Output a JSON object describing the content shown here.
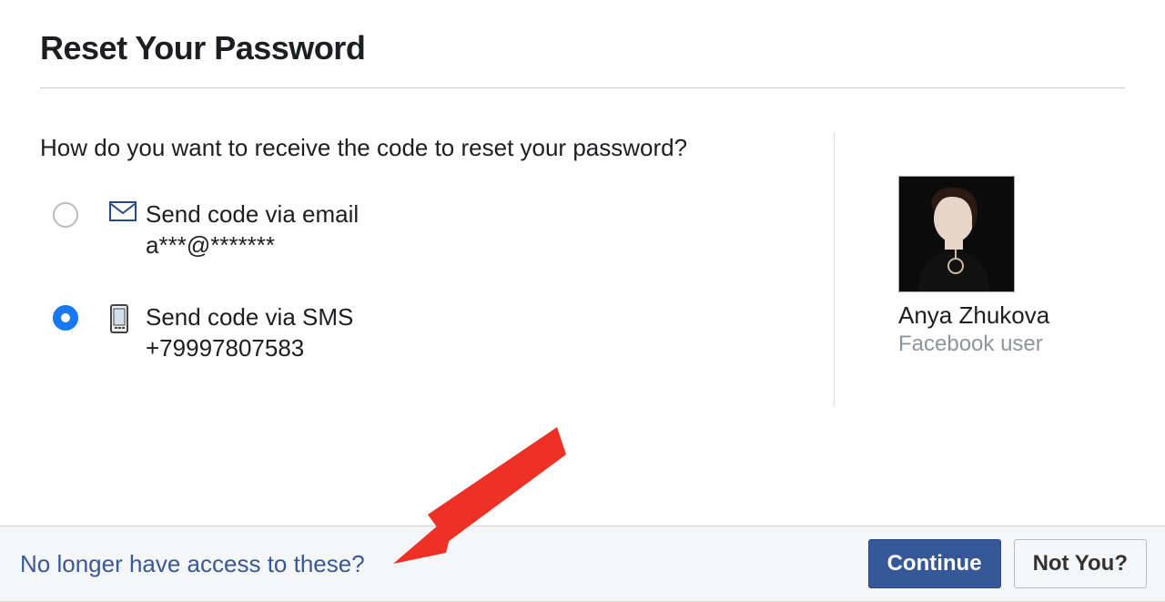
{
  "title": "Reset Your Password",
  "prompt": "How do you want to receive the code to reset your password?",
  "options": [
    {
      "label": "Send code via email",
      "detail": "a***@*******",
      "selected": false
    },
    {
      "label": "Send code via SMS",
      "detail": "+79997807583",
      "selected": true
    }
  ],
  "user": {
    "name": "Anya Zhukova",
    "role": "Facebook user"
  },
  "footer": {
    "no_access_link": "No longer have access to these?",
    "continue_label": "Continue",
    "not_you_label": "Not You?"
  }
}
